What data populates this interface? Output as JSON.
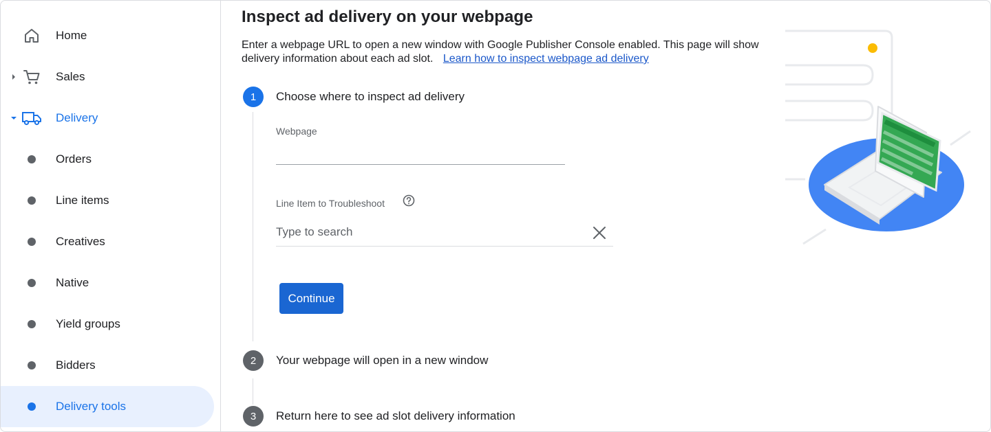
{
  "sidebar": {
    "items": [
      {
        "label": "Home",
        "icon": "home-icon"
      },
      {
        "label": "Sales",
        "icon": "cart-icon"
      },
      {
        "label": "Delivery",
        "icon": "truck-icon"
      },
      {
        "label": "Orders"
      },
      {
        "label": "Line items"
      },
      {
        "label": "Creatives"
      },
      {
        "label": "Native"
      },
      {
        "label": "Yield groups"
      },
      {
        "label": "Bidders"
      },
      {
        "label": "Delivery tools"
      }
    ]
  },
  "main": {
    "title": "Inspect ad delivery on your webpage",
    "description": "Enter a webpage URL to open a new window with Google Publisher Console enabled. This page will show delivery information about each ad slot.",
    "learn_link": "Learn how to inspect webpage ad delivery",
    "steps": [
      {
        "number": "1",
        "label": "Choose where to inspect ad delivery"
      },
      {
        "number": "2",
        "label": "Your webpage will open in a new window"
      },
      {
        "number": "3",
        "label": "Return here to see ad slot delivery information"
      }
    ],
    "webpage_field": {
      "label": "Webpage",
      "value": ""
    },
    "line_item_field": {
      "label": "Line Item to Troubleshoot",
      "placeholder": "Type to search",
      "value": ""
    },
    "continue_label": "Continue"
  },
  "colors": {
    "accent": "#1a73e8",
    "selected_bg": "#e8f0fe",
    "inactive_step": "#5f6368",
    "illustration_green": "#34a853",
    "illustration_blue": "#4285f4",
    "illustration_yellow": "#fbbc04"
  }
}
